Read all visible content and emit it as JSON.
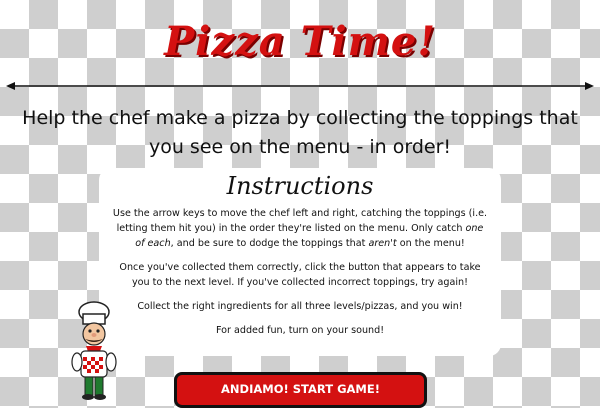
{
  "header": {
    "title": "Pizza Time!",
    "subtitle_line1": "Help the chef make a pizza by collecting the toppings that",
    "subtitle_line2": "you see on the menu - in order!"
  },
  "instructions": {
    "heading": "Instructions",
    "p1_a": "Use the arrow keys to move the chef left and right, catching the toppings (i.e. letting them hit you) in the order they're listed on the menu. Only catch ",
    "p1_em1": "one of each",
    "p1_b": ", and be sure to dodge the toppings that ",
    "p1_em2": "aren't",
    "p1_c": " on the menu!",
    "p2": "Once you've collected them correctly, click the button that appears to take you to the next level. If you've collected incorrect toppings, try again!",
    "p3": "Collect the right ingredients for all three levels/pizzas, and you win!",
    "p4": "For added fun, turn on your sound!"
  },
  "start_button": {
    "label": "ANDIAMO! START GAME!"
  },
  "colors": {
    "accent": "#d41111",
    "checker": "#cfcfcf",
    "text": "#111111"
  },
  "icons": {
    "chef": "chef-character-icon",
    "divider": "arrow-divider"
  }
}
